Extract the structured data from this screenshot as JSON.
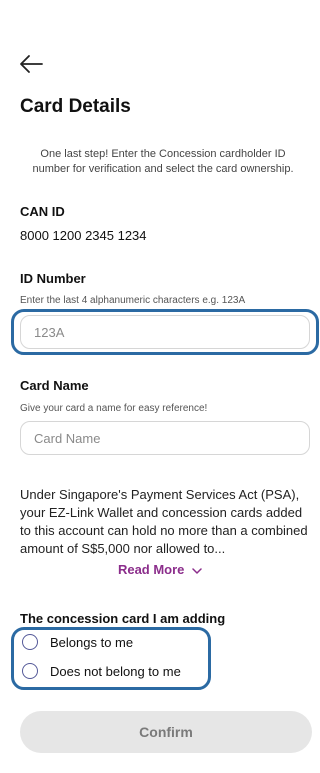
{
  "header": {
    "back_icon": "arrow-left-icon",
    "title": "Card Details"
  },
  "intro": "One last step! Enter the Concession cardholder ID number for verification and select the card ownership.",
  "can_id": {
    "label": "CAN ID",
    "value": "8000 1200 2345 1234"
  },
  "id_number": {
    "label": "ID Number",
    "hint": "Enter the last 4 alphanumeric characters e.g. 123A",
    "placeholder": "123A"
  },
  "card_name": {
    "label": "Card Name",
    "hint": "Give your card a name for easy reference!",
    "placeholder": "Card Name"
  },
  "psa_text": "Under Singapore's Payment Services Act (PSA), your EZ-Link Wallet and concession cards added to this account can hold no more than a combined amount of S$5,000 nor allowed to...",
  "read_more": {
    "label": "Read More",
    "icon": "chevron-down-icon"
  },
  "ownership": {
    "label": "The concession card I am adding",
    "options": [
      "Belongs to me",
      "Does not belong to me"
    ]
  },
  "confirm_label": "Confirm",
  "colors": {
    "highlight": "#2b6aa3",
    "accent": "#8b2d8b",
    "disabled_bg": "#e6e6e6"
  }
}
